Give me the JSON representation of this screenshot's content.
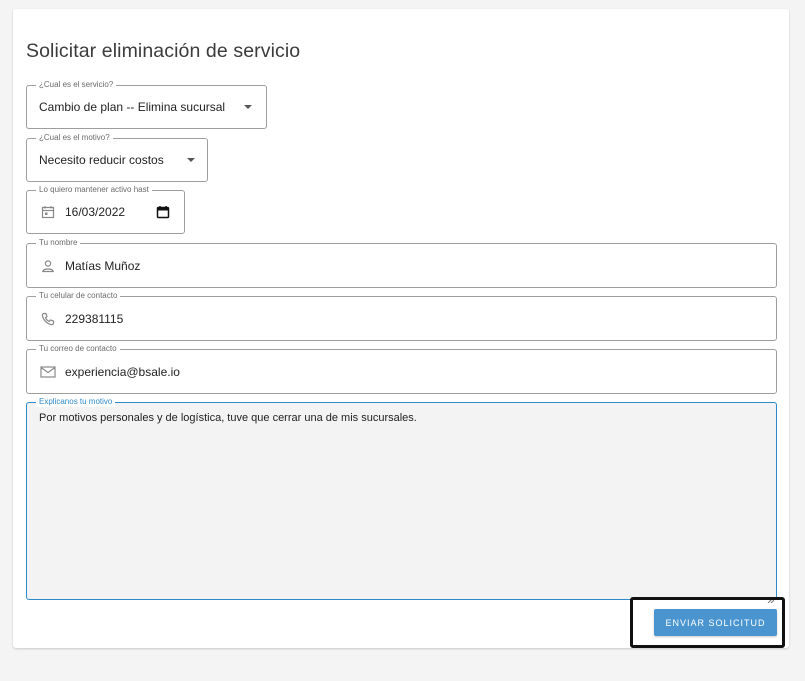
{
  "form": {
    "title": "Solicitar eliminación de servicio",
    "service": {
      "label": "¿Cual es el servicio?",
      "value": "Cambio de plan -- Elimina sucursal"
    },
    "reason": {
      "label": "¿Cual es el motivo?",
      "value": "Necesito reducir costos"
    },
    "keep_until": {
      "label": "Lo quiero mantener activo hast",
      "value": "16/03/2022"
    },
    "name": {
      "label": "Tu nombre",
      "value": "Matías Muñoz"
    },
    "phone": {
      "label": "Tu celular de contacto",
      "value": "229381115"
    },
    "email": {
      "label": "Tu correo de contacto",
      "value": "experiencia@bsale.io"
    },
    "explanation": {
      "label": "Explicanos tu motivo",
      "value": "Por motivos personales y de logística, tuve que cerrar una de mis sucursales."
    },
    "submit_label": "ENVIAR SOLICITUD"
  },
  "icons": {
    "calendar": "calendar-icon",
    "calendar_picker": "calendar-picker-icon",
    "person": "person-icon",
    "phone": "phone-icon",
    "mail": "mail-icon",
    "caret": "caret-down-icon"
  },
  "colors": {
    "accent": "#4a95cf",
    "focus_border": "#2e8bc9",
    "highlight_box": "#111111"
  }
}
